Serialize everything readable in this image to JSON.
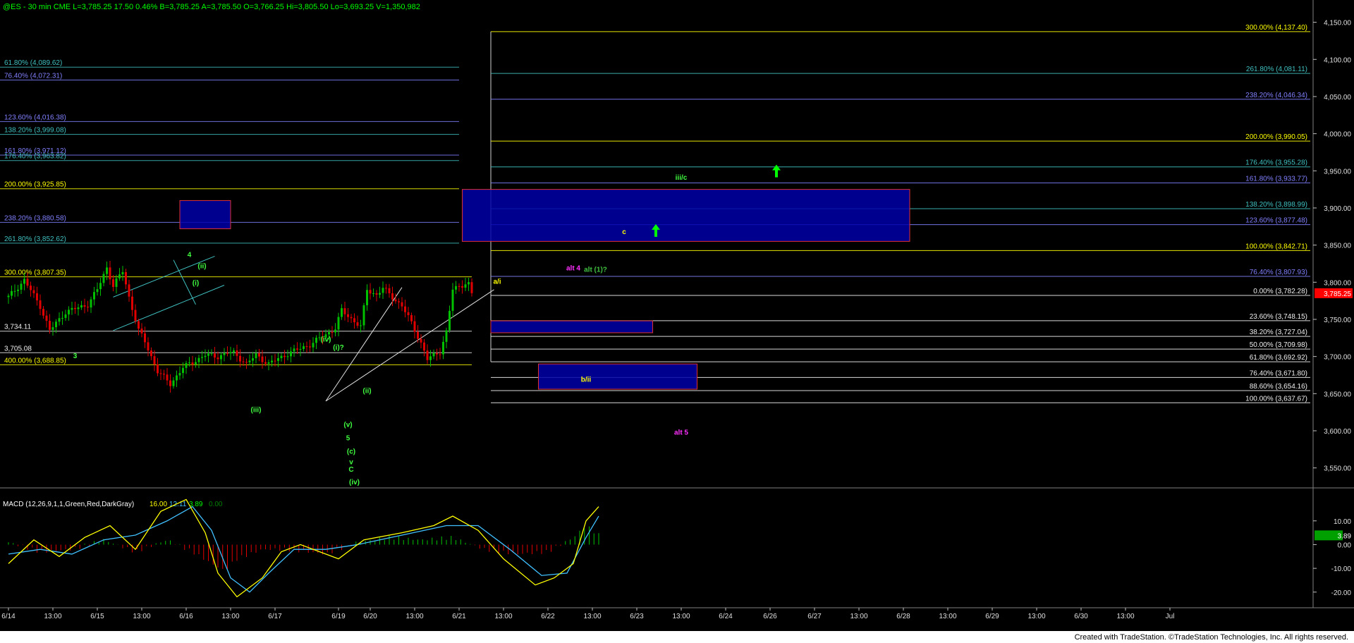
{
  "header": {
    "text": "@ES - 30 min  CME   L=3,785.25  17.50  0.46%   B=3,785.25  A=3,785.50  O=3,766.25  Hi=3,805.50  Lo=3,693.25  V=1,350,982"
  },
  "footer": {
    "text": "Created with TradeStation. ©TradeStation Technologies, Inc. All rights reserved."
  },
  "colors": {
    "background": "#000000",
    "up_candle": "#00c000",
    "down_candle": "#e00000",
    "last_price_box": "#ff0000",
    "macd_box": "#00a000",
    "blue_box": "#0000a8",
    "box_border": "#e03030",
    "fib_white": "#f0f0f0",
    "fib_yellow": "#ffff00",
    "fib_green": "#60c060",
    "fib_blue": "#8080ff",
    "fib_cyan": "#40c0c0",
    "wave_green": "#40ff40",
    "wave_magenta": "#ff30ff",
    "arrow_green": "#00ff00"
  },
  "chart_data": [
    {
      "type": "line",
      "title": "@ES - 30 min CME",
      "price_axis": {
        "ticks": [
          "4,150.00",
          "4,100.00",
          "4,050.00",
          "4,000.00",
          "3,950.00",
          "3,900.00",
          "3,850.00",
          "3,800.00",
          "3,750.00",
          "3,700.00",
          "3,650.00",
          "3,600.00",
          "3,550.00"
        ],
        "tick_values": [
          4150,
          4100,
          4050,
          4000,
          3950,
          3900,
          3850,
          3800,
          3750,
          3700,
          3650,
          3600,
          3550
        ],
        "range": [
          3525,
          4180
        ],
        "last_price_label": "3,785.25",
        "last_price": 3785.25
      },
      "time_axis": {
        "labels": [
          "6/14",
          "13:00",
          "6/15",
          "13:00",
          "6/16",
          "13:00",
          "6/17",
          "6/19",
          "6/20",
          "13:00",
          "6/21",
          "13:00",
          "6/22",
          "13:00",
          "6/23",
          "13:00",
          "6/24",
          "6/26",
          "6/27",
          "13:00",
          "6/28",
          "13:00",
          "6/29",
          "13:00",
          "6/30",
          "13:00",
          "Jul"
        ],
        "bar_index": [
          0,
          14,
          28,
          42,
          56,
          70,
          84,
          104,
          114,
          128,
          142,
          156,
          170,
          184,
          198,
          212,
          226,
          240,
          254,
          268,
          282,
          296,
          310,
          324,
          338,
          352,
          366
        ]
      },
      "series_path": [
        [
          0,
          3780
        ],
        [
          5,
          3803
        ],
        [
          10,
          3768
        ],
        [
          13,
          3735
        ],
        [
          18,
          3760
        ],
        [
          25,
          3770
        ],
        [
          28,
          3790
        ],
        [
          31,
          3820
        ],
        [
          33,
          3795
        ],
        [
          36,
          3815
        ],
        [
          38,
          3780
        ],
        [
          41,
          3735
        ],
        [
          43,
          3720
        ],
        [
          47,
          3680
        ],
        [
          51,
          3663
        ],
        [
          55,
          3685
        ],
        [
          62,
          3702
        ],
        [
          66,
          3700
        ],
        [
          69,
          3705
        ],
        [
          71,
          3705
        ],
        [
          75,
          3690
        ],
        [
          78,
          3702
        ],
        [
          82,
          3690
        ],
        [
          88,
          3704
        ],
        [
          95,
          3716
        ],
        [
          103,
          3738
        ],
        [
          105,
          3762
        ],
        [
          111,
          3740
        ],
        [
          113,
          3790
        ],
        [
          116,
          3783
        ],
        [
          118,
          3792
        ],
        [
          121,
          3780
        ],
        [
          124,
          3768
        ],
        [
          127,
          3745
        ],
        [
          130,
          3718
        ],
        [
          132,
          3696
        ],
        [
          136,
          3707
        ],
        [
          138,
          3733
        ],
        [
          140,
          3790
        ],
        [
          144,
          3799
        ],
        [
          146,
          3796
        ]
      ],
      "series_path_units": "x = bar index along the time axis, y = price",
      "candle_count": 147,
      "fib_left": [
        {
          "label": "61.80% (4,089.62)",
          "value": 4089.62,
          "color": "#40c0c0"
        },
        {
          "label": "76.40% (4,072.31)",
          "value": 4072.31,
          "color": "#8080ff"
        },
        {
          "label": "123.60% (4,016.38)",
          "value": 4016.38,
          "color": "#8080ff"
        },
        {
          "label": "138.20% (3,999.08)",
          "value": 3999.08,
          "color": "#40c0c0"
        },
        {
          "label": "161.80% (3,971.12)",
          "value": 3971.12,
          "color": "#8080ff"
        },
        {
          "label": "176.40% (3,963.82)",
          "value": 3963.82,
          "color": "#40c0c0"
        },
        {
          "label": "200.00% (3,925.85)",
          "value": 3925.85,
          "color": "#ffff00"
        },
        {
          "label": "238.20% (3,880.58)",
          "value": 3880.58,
          "color": "#8080ff"
        },
        {
          "label": "261.80% (3,852.62)",
          "value": 3852.62,
          "color": "#40c0c0"
        },
        {
          "label": "300.00% (3,807.35)",
          "value": 3807.35,
          "color": "#ffff00"
        },
        {
          "label": "3,734.11",
          "value": 3734.11,
          "color": "#f0f0f0"
        },
        {
          "label": "3,705.08",
          "value": 3705.08,
          "color": "#f0f0f0"
        },
        {
          "label": "400.00% (3,688.85)",
          "value": 3688.85,
          "color": "#ffff00"
        }
      ],
      "fib_right": [
        {
          "label": "300.00% (4,137.40)",
          "value": 4137.4,
          "color": "#ffff00"
        },
        {
          "label": "261.80% (4,081.11)",
          "value": 4081.11,
          "color": "#40c0c0"
        },
        {
          "label": "238.20% (4,046.34)",
          "value": 4046.34,
          "color": "#8080ff"
        },
        {
          "label": "200.00% (3,990.05)",
          "value": 3990.05,
          "color": "#ffff00"
        },
        {
          "label": "176.40% (3,955.28)",
          "value": 3955.28,
          "color": "#40c0c0"
        },
        {
          "label": "161.80% (3,933.77)",
          "value": 3933.77,
          "color": "#8080ff"
        },
        {
          "label": "138.20% (3,898.99)",
          "value": 3898.99,
          "color": "#40c0c0"
        },
        {
          "label": "123.60% (3,877.48)",
          "value": 3877.48,
          "color": "#8080ff"
        },
        {
          "label": "100.00% (3,842.71)",
          "value": 3842.71,
          "color": "#ffff00"
        },
        {
          "label": "76.40% (3,807.93)",
          "value": 3807.93,
          "color": "#8080ff"
        },
        {
          "label": "0.00% (3,782.28)",
          "value": 3782.28,
          "color": "#f0f0f0"
        },
        {
          "label": "23.60% (3,748.15)",
          "value": 3748.15,
          "color": "#f0f0f0"
        },
        {
          "label": "38.20% (3,727.04)",
          "value": 3727.04,
          "color": "#f0f0f0"
        },
        {
          "label": "50.00% (3,709.98)",
          "value": 3709.98,
          "color": "#f0f0f0"
        },
        {
          "label": "61.80% (3,692.92)",
          "value": 3692.92,
          "color": "#f0f0f0"
        },
        {
          "label": "76.40% (3,671.80)",
          "value": 3671.8,
          "color": "#f0f0f0"
        },
        {
          "label": "88.60% (3,654.16)",
          "value": 3654.16,
          "color": "#f0f0f0"
        },
        {
          "label": "100.00% (3,637.67)",
          "value": 3637.67,
          "color": "#f0f0f0"
        }
      ],
      "boxes": [
        {
          "name": "box-left",
          "x": [
            54,
            70
          ],
          "y": [
            3872,
            3910
          ]
        },
        {
          "name": "box-big",
          "x": [
            143,
            284
          ],
          "y": [
            3855,
            3925
          ]
        },
        {
          "name": "box-mid",
          "x": [
            152,
            203
          ],
          "y": [
            3732,
            3748
          ]
        },
        {
          "name": "box-bii",
          "x": [
            167,
            217
          ],
          "y": [
            3656,
            3690
          ]
        }
      ],
      "wave_labels": [
        {
          "text": "4",
          "bar": 57,
          "price": 3834,
          "color": "#40ff40"
        },
        {
          "text": "(ii)",
          "bar": 61,
          "price": 3819,
          "color": "#40ff40"
        },
        {
          "text": "(i)",
          "bar": 59,
          "price": 3796,
          "color": "#40ff40"
        },
        {
          "text": "3",
          "bar": 21,
          "price": 3698,
          "color": "#40ff40"
        },
        {
          "text": "(iii)",
          "bar": 78,
          "price": 3625,
          "color": "#40ff40"
        },
        {
          "text": "(iv)",
          "bar": 100,
          "price": 3720,
          "color": "#40ff40"
        },
        {
          "text": "(i)?",
          "bar": 104,
          "price": 3709,
          "color": "#40ff40"
        },
        {
          "text": "(ii)",
          "bar": 113,
          "price": 3651,
          "color": "#40ff40"
        },
        {
          "text": "(v)",
          "bar": 107,
          "price": 3605,
          "color": "#40ff40"
        },
        {
          "text": "5",
          "bar": 107,
          "price": 3587,
          "color": "#40ff40"
        },
        {
          "text": "(c)",
          "bar": 108,
          "price": 3569,
          "color": "#40ff40"
        },
        {
          "text": "v",
          "bar": 108,
          "price": 3555,
          "color": "#40ff40"
        },
        {
          "text": "C",
          "bar": 108,
          "price": 3545,
          "color": "#40ff40"
        },
        {
          "text": "(iv)",
          "bar": 109,
          "price": 3528,
          "color": "#40ff40"
        },
        {
          "text": "a/i",
          "bar": 154,
          "price": 3798,
          "color": "#ffff00"
        },
        {
          "text": "b/ii",
          "bar": 182,
          "price": 3666,
          "color": "#ffff00"
        },
        {
          "text": "c",
          "bar": 194,
          "price": 3865,
          "color": "#ffff00"
        },
        {
          "text": "iii/c",
          "bar": 212,
          "price": 3938,
          "color": "#40ff40"
        },
        {
          "text": "alt 4",
          "bar": 178,
          "price": 3816,
          "color": "#ff30ff"
        },
        {
          "text": "alt (1)?",
          "bar": 185,
          "price": 3814,
          "color": "#40c040"
        },
        {
          "text": "alt 5",
          "bar": 212,
          "price": 3595,
          "color": "#ff30ff"
        }
      ],
      "arrows": [
        {
          "bar": 204,
          "price": 3865
        },
        {
          "bar": 242,
          "price": 3945
        }
      ],
      "trendlines": [
        {
          "from": [
            33,
            3780
          ],
          "to": [
            65,
            3835
          ],
          "color": "#40c0c0"
        },
        {
          "from": [
            33,
            3735
          ],
          "to": [
            68,
            3796
          ],
          "color": "#40c0c0"
        },
        {
          "from": [
            52,
            3830
          ],
          "to": [
            59,
            3770
          ],
          "color": "#40c0c0"
        },
        {
          "from": [
            100,
            3640
          ],
          "to": [
            124,
            3793
          ],
          "color": "#e0e0e0"
        },
        {
          "from": [
            100,
            3640
          ],
          "to": [
            153,
            3790
          ],
          "color": "#e0e0e0"
        }
      ]
    },
    {
      "type": "bar",
      "title": "MACD (12,26,9,1,1,Green,Red,DarkGray)",
      "values_text": [
        "16.00",
        "12.11",
        "3.89",
        "0.00"
      ],
      "value_colors": [
        "#ffff00",
        "#40c0ff",
        "#00ff00",
        "#008000"
      ],
      "y_ticks": [
        "10.00",
        "0.00",
        "-10.00",
        "-20.00"
      ],
      "y_tick_values": [
        10,
        0,
        -10,
        -20
      ],
      "y_range": [
        -26,
        23
      ],
      "last_value_label": "3.89",
      "macd_path": [
        [
          0,
          -8
        ],
        [
          8,
          2
        ],
        [
          16,
          -5
        ],
        [
          24,
          3
        ],
        [
          32,
          8
        ],
        [
          40,
          -2
        ],
        [
          48,
          14
        ],
        [
          56,
          19
        ],
        [
          62,
          5
        ],
        [
          66,
          -12
        ],
        [
          72,
          -22
        ],
        [
          80,
          -14
        ],
        [
          86,
          -3
        ],
        [
          92,
          0
        ],
        [
          100,
          -4
        ],
        [
          104,
          -6
        ],
        [
          112,
          2
        ],
        [
          124,
          5
        ],
        [
          134,
          8
        ],
        [
          140,
          12
        ],
        [
          148,
          6
        ],
        [
          156,
          -6
        ],
        [
          166,
          -17
        ],
        [
          172,
          -14
        ],
        [
          178,
          -8
        ],
        [
          182,
          10
        ],
        [
          186,
          16
        ]
      ],
      "signal_path": [
        [
          0,
          -4
        ],
        [
          10,
          -2
        ],
        [
          20,
          -4
        ],
        [
          30,
          2
        ],
        [
          40,
          4
        ],
        [
          50,
          10
        ],
        [
          58,
          16
        ],
        [
          64,
          6
        ],
        [
          70,
          -14
        ],
        [
          76,
          -20
        ],
        [
          82,
          -12
        ],
        [
          90,
          -2
        ],
        [
          100,
          -2
        ],
        [
          110,
          0
        ],
        [
          124,
          4
        ],
        [
          138,
          8
        ],
        [
          148,
          8
        ],
        [
          158,
          -2
        ],
        [
          168,
          -13
        ],
        [
          176,
          -12
        ],
        [
          182,
          3
        ],
        [
          186,
          12
        ]
      ],
      "histogram_path": [
        [
          0,
          1
        ],
        [
          10,
          -3
        ],
        [
          20,
          -2
        ],
        [
          30,
          2
        ],
        [
          40,
          -3
        ],
        [
          50,
          2
        ],
        [
          58,
          -3
        ],
        [
          64,
          -8
        ],
        [
          68,
          -11
        ],
        [
          72,
          -6
        ],
        [
          80,
          -2
        ],
        [
          88,
          -2
        ],
        [
          100,
          -4
        ],
        [
          110,
          1
        ],
        [
          120,
          3
        ],
        [
          130,
          2
        ],
        [
          140,
          3
        ],
        [
          150,
          -2
        ],
        [
          160,
          -4
        ],
        [
          170,
          -3
        ],
        [
          178,
          3
        ],
        [
          182,
          8
        ],
        [
          186,
          4
        ]
      ],
      "series": [
        {
          "name": "MACD",
          "color": "#ffff00"
        },
        {
          "name": "Signal",
          "color": "#40c0ff"
        },
        {
          "name": "Histogram",
          "color": "#00c000"
        }
      ]
    }
  ]
}
